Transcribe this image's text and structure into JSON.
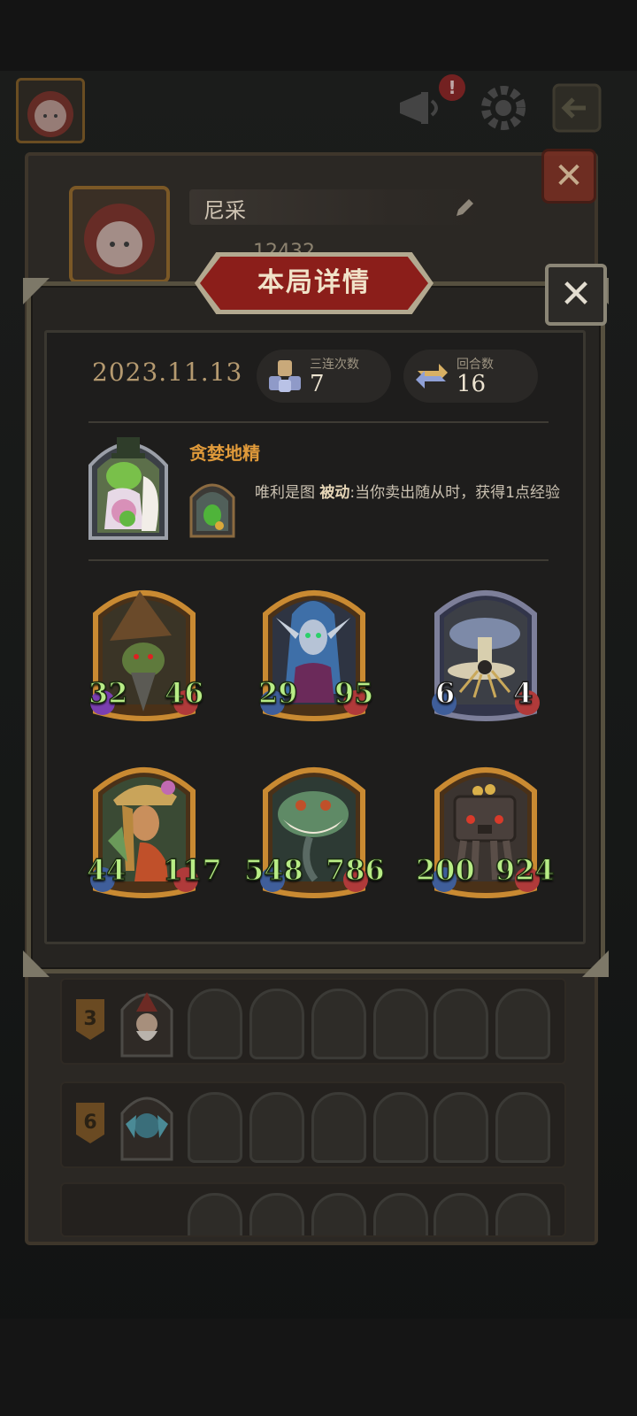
{
  "background": {
    "profile": {
      "name": "尼采",
      "score": "12432"
    },
    "notice_badge": "!",
    "history": [
      {
        "rank": "3"
      },
      {
        "rank": "6"
      }
    ]
  },
  "modal": {
    "title": "本局详情",
    "close_icon": "close-x",
    "date": "2023.11.13",
    "stats": [
      {
        "label": "三连次数",
        "value": "7",
        "icon": "triple-units-icon"
      },
      {
        "label": "回合数",
        "value": "16",
        "icon": "rounds-arrows-icon"
      }
    ],
    "hero": {
      "name": "贪婪地精",
      "skill_name": "唯利是图",
      "skill_type": "被动",
      "skill_text": ":当你卖出随从时，获得1点经验"
    },
    "units": [
      {
        "name": "goblin-witch",
        "attack": "32",
        "health": "46",
        "frame": "gold"
      },
      {
        "name": "elf-sorceress",
        "attack": "29",
        "health": "95",
        "frame": "gold"
      },
      {
        "name": "mushroom-spider",
        "attack": "6",
        "health": "4",
        "frame": "silver"
      },
      {
        "name": "flower-girl",
        "attack": "44",
        "health": "117",
        "frame": "gold"
      },
      {
        "name": "grinning-plant",
        "attack": "548",
        "health": "786",
        "frame": "gold"
      },
      {
        "name": "treasure-chest-golem",
        "attack": "200",
        "health": "924",
        "frame": "gold"
      }
    ]
  },
  "colors": {
    "accent_red": "#8b1e1a",
    "hero_name": "#e09a3a",
    "stat_green": "#b8ec86",
    "frame_gold": "#c98a32",
    "frame_silver": "#7d7f9a"
  }
}
